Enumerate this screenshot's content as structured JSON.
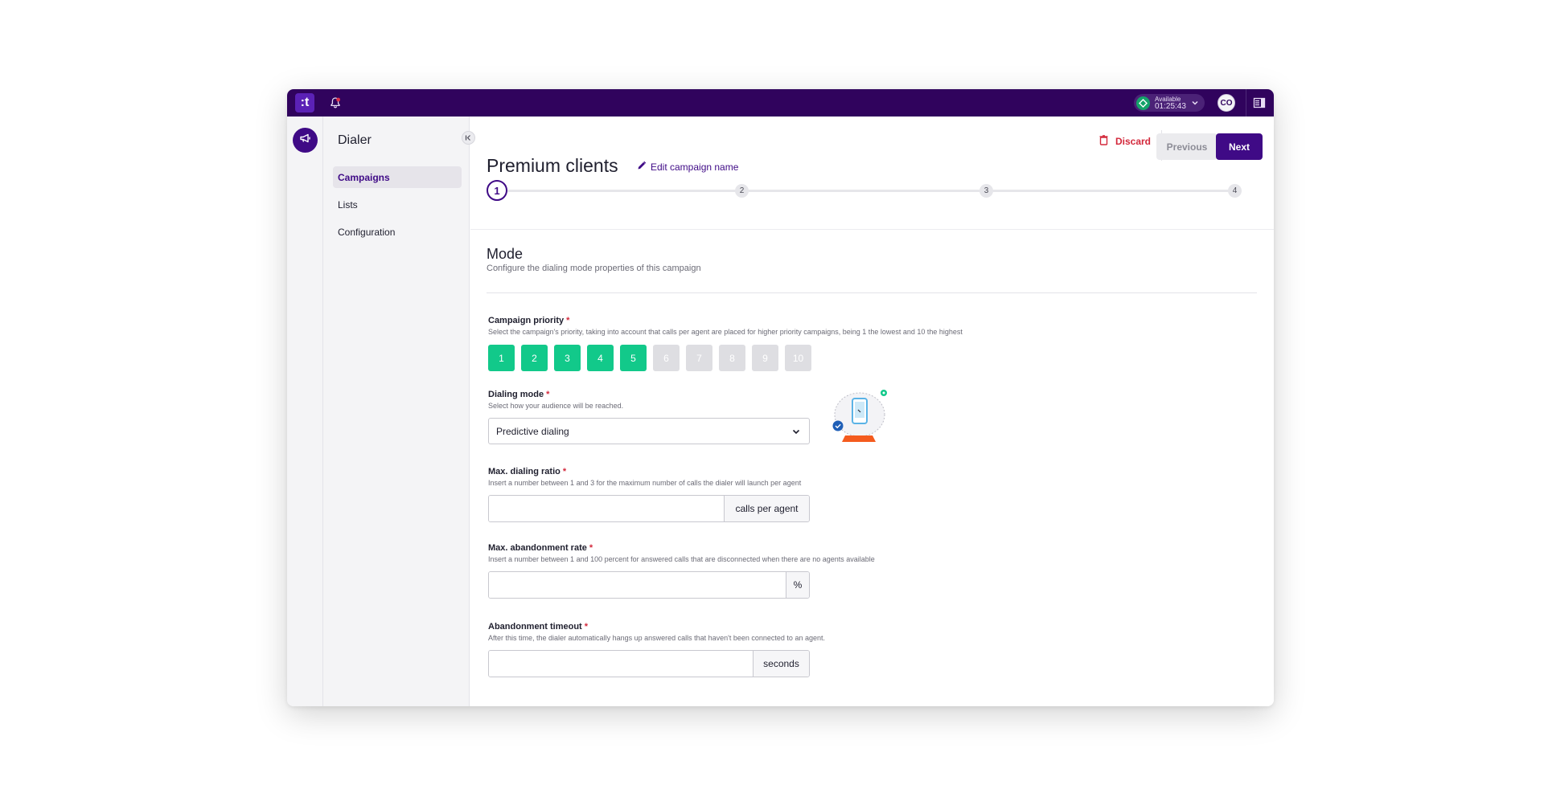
{
  "topbar": {
    "logo_text": ":t",
    "status": {
      "label": "Available",
      "time": "01:25:43",
      "color": "#14a36a"
    },
    "avatar_initials": "CO",
    "bg_color": "#30035d"
  },
  "sidebar": {
    "title": "Dialer",
    "items": [
      {
        "label": "Campaigns",
        "active": true
      },
      {
        "label": "Lists",
        "active": false
      },
      {
        "label": "Configuration",
        "active": false
      }
    ]
  },
  "header": {
    "title": "Premium clients",
    "edit_label": "Edit campaign name",
    "discard_label": "Discard",
    "previous_label": "Previous",
    "next_label": "Next"
  },
  "stepper": {
    "steps": [
      "1",
      "2",
      "3",
      "4"
    ],
    "current": 1
  },
  "section": {
    "title": "Mode",
    "subtitle": "Configure the dialing mode properties of this campaign"
  },
  "form": {
    "priority": {
      "label": "Campaign priority",
      "required": "*",
      "help": "Select the campaign's priority, taking into account that calls per agent are placed for higher priority campaigns, being 1 the lowest and 10 the highest",
      "options": [
        "1",
        "2",
        "3",
        "4",
        "5",
        "6",
        "7",
        "8",
        "9",
        "10"
      ],
      "selected": 5,
      "active_color": "#12c98a"
    },
    "dialing_mode": {
      "label": "Dialing mode",
      "required": "*",
      "help": "Select how your audience will be reached.",
      "value": "Predictive dialing"
    },
    "max_ratio": {
      "label": "Max. dialing ratio",
      "required": "*",
      "help": "Insert a number between 1 and 3 for the maximum number of calls the dialer will launch per agent",
      "value": "",
      "suffix": "calls per agent"
    },
    "max_abandonment": {
      "label": "Max. abandonment rate",
      "required": "*",
      "help": "Insert a number between 1 and 100 percent for answered calls that are disconnected when there are no agents available",
      "value": "",
      "suffix": "%"
    },
    "abandonment_timeout": {
      "label": "Abandonment timeout",
      "required": "*",
      "help": "After this time, the dialer automatically hangs up answered calls that haven't been connected to an agent.",
      "value": "",
      "suffix": "seconds"
    }
  },
  "colors": {
    "primary": "#3f0a86",
    "danger": "#d3283b"
  }
}
